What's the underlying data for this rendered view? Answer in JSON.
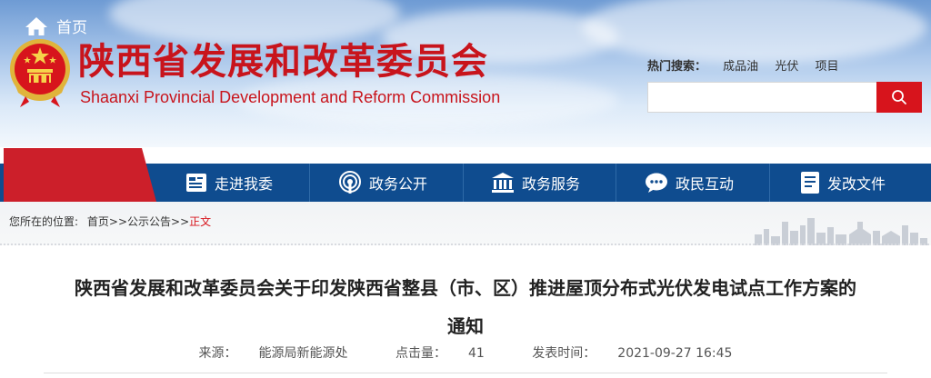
{
  "header": {
    "site_name": "陕西省发展和改革委员会",
    "site_name_en": "Shaanxi Provincial Development and Reform Commission",
    "hotwords_label": "热门搜索：",
    "hotwords": [
      "成品油",
      "光伏",
      "项目"
    ],
    "search_placeholder": ""
  },
  "nav": {
    "home": "首页",
    "items": [
      {
        "label": "走进我委",
        "icon": "id-card-icon"
      },
      {
        "label": "政务公开",
        "icon": "broadcast-icon"
      },
      {
        "label": "政务服务",
        "icon": "building-icon"
      },
      {
        "label": "政民互动",
        "icon": "chat-icon"
      },
      {
        "label": "发改文件",
        "icon": "document-icon"
      }
    ]
  },
  "breadcrumb": {
    "prefix": "您所在的位置:",
    "home": "首页",
    "sep1": ">>",
    "section": "公示公告",
    "sep2": ">>",
    "current": "正文"
  },
  "article": {
    "title": "陕西省发展和改革委员会关于印发陕西省整县（市、区）推进屋顶分布式光伏发电试点工作方案的通知",
    "source_label": "来源：",
    "source": "能源局新能源处",
    "hits_label": "点击量：",
    "hits": "41",
    "time_label": "发表时间：",
    "time": "2021-09-27 16:45"
  },
  "colors": {
    "brand_red": "#c8141c",
    "nav_blue": "#0f4c8f",
    "home_red": "#cc1f2a"
  }
}
